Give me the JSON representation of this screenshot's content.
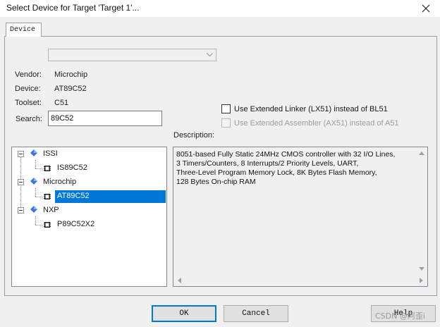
{
  "window": {
    "title": "Select Device for Target 'Target 1'...",
    "close_icon": "close-icon"
  },
  "tabs": [
    {
      "label": "Device",
      "active": true
    }
  ],
  "device_combo": {
    "value": ""
  },
  "info": {
    "vendor_label": "Vendor:",
    "vendor_value": "Microchip",
    "device_label": "Device:",
    "device_value": "AT89C52",
    "toolset_label": "Toolset:",
    "toolset_value": "C51",
    "search_label": "Search:",
    "search_value": "89C52"
  },
  "options": {
    "extended_linker": {
      "label": "Use Extended Linker (LX51) instead of BL51",
      "checked": false,
      "enabled": true
    },
    "extended_assembler": {
      "label": "Use Extended Assembler (AX51) instead of A51",
      "checked": false,
      "enabled": false
    }
  },
  "tree": {
    "vendors": [
      {
        "name": "ISSI",
        "icon": "vendor-diamond-icon",
        "devices": [
          {
            "name": "IS89C52",
            "selected": false
          }
        ]
      },
      {
        "name": "Microchip",
        "icon": "vendor-diamond-icon",
        "devices": [
          {
            "name": "AT89C52",
            "selected": true
          }
        ]
      },
      {
        "name": "NXP",
        "icon": "vendor-diamond-icon",
        "devices": [
          {
            "name": "P89C52X2",
            "selected": false
          }
        ]
      }
    ]
  },
  "description": {
    "label": "Description:",
    "text": "8051-based Fully Static 24MHz CMOS controller with 32  I/O Lines,\n3 Timers/Counters, 8 Interrupts/2 Priority Levels, UART,\nThree-Level Program Memory Lock, 8K Bytes Flash Memory,\n128 Bytes On-chip RAM"
  },
  "buttons": {
    "ok": "OK",
    "cancel": "Cancel",
    "help": "Help"
  },
  "watermark": "CSDN @阿歪i",
  "colors": {
    "selection": "#0078d7",
    "window_bg": "#f0f0f0"
  }
}
